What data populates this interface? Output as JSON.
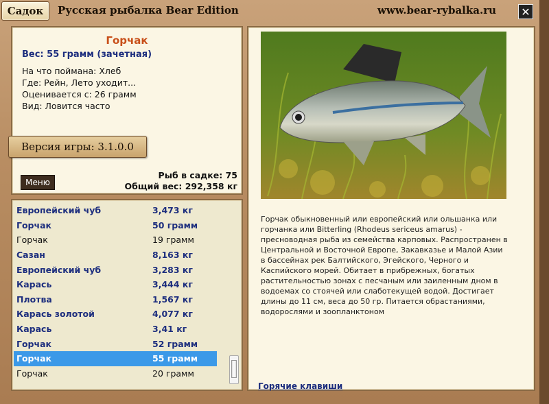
{
  "titlebar": {
    "sadok_label": "Садок",
    "app_title": "Русская рыбалка Bear Edition",
    "site": "www.bear-rybalka.ru",
    "close_label": "✕"
  },
  "fish": {
    "name": "Горчак",
    "weight": "Вес: 55 грамм (зачетная)",
    "caught_on": "На что поймана: Хлеб",
    "where": "Где: Рейн, Лето уходит...",
    "rated_from": "Оценивается с: 26 грамм",
    "kind": "Вид: Ловится часто"
  },
  "version": "Версия игры: 3.1.0.0",
  "menu_label": "Меню",
  "stats": {
    "count": "Рыб в садке: 75",
    "total": "Общий вес: 292,358 кг"
  },
  "catch_list": [
    {
      "name": "Европейский чуб",
      "weight": "3,473 кг",
      "bold": true
    },
    {
      "name": "Горчак",
      "weight": "50 грамм",
      "bold": true
    },
    {
      "name": "Горчак",
      "weight": "19 грамм",
      "bold": false
    },
    {
      "name": "Сазан",
      "weight": "8,163 кг",
      "bold": true
    },
    {
      "name": "Европейский чуб",
      "weight": "3,283 кг",
      "bold": true
    },
    {
      "name": "Карась",
      "weight": "3,444 кг",
      "bold": true
    },
    {
      "name": "Плотва",
      "weight": "1,567 кг",
      "bold": true
    },
    {
      "name": "Карась золотой",
      "weight": "4,077 кг",
      "bold": true
    },
    {
      "name": "Карась",
      "weight": "3,41 кг",
      "bold": true
    },
    {
      "name": "Горчак",
      "weight": "52 грамм",
      "bold": true
    },
    {
      "name": "Горчак",
      "weight": "55 грамм",
      "bold": true,
      "selected": true
    },
    {
      "name": "Горчак",
      "weight": "20 грамм",
      "bold": false
    }
  ],
  "description": "Горчак обыкновенный или европейский или ольшанка или горчанка или Bitterling (Rhodeus sericeus amarus) - пресноводная рыба из семейства карповых. Распространен в Центральной и Восточной Европе, Закавказье и Малой Азии в бассейнах рек Балтийского, Эгейского, Черного и Каспийского морей. Обитает в прибрежных, богатых растительностью зонах с песчаным или заиленным дном в водоемах со стоячей или слаботекущей водой. Достигает длины до 11 см, веса до 50 гр. Питается обрастаниями, водорослями и зоопланктоном",
  "hotkeys_label": "Горячие клавиши",
  "icons": {
    "close": "close-icon",
    "scrollbar": "scrollbar"
  }
}
